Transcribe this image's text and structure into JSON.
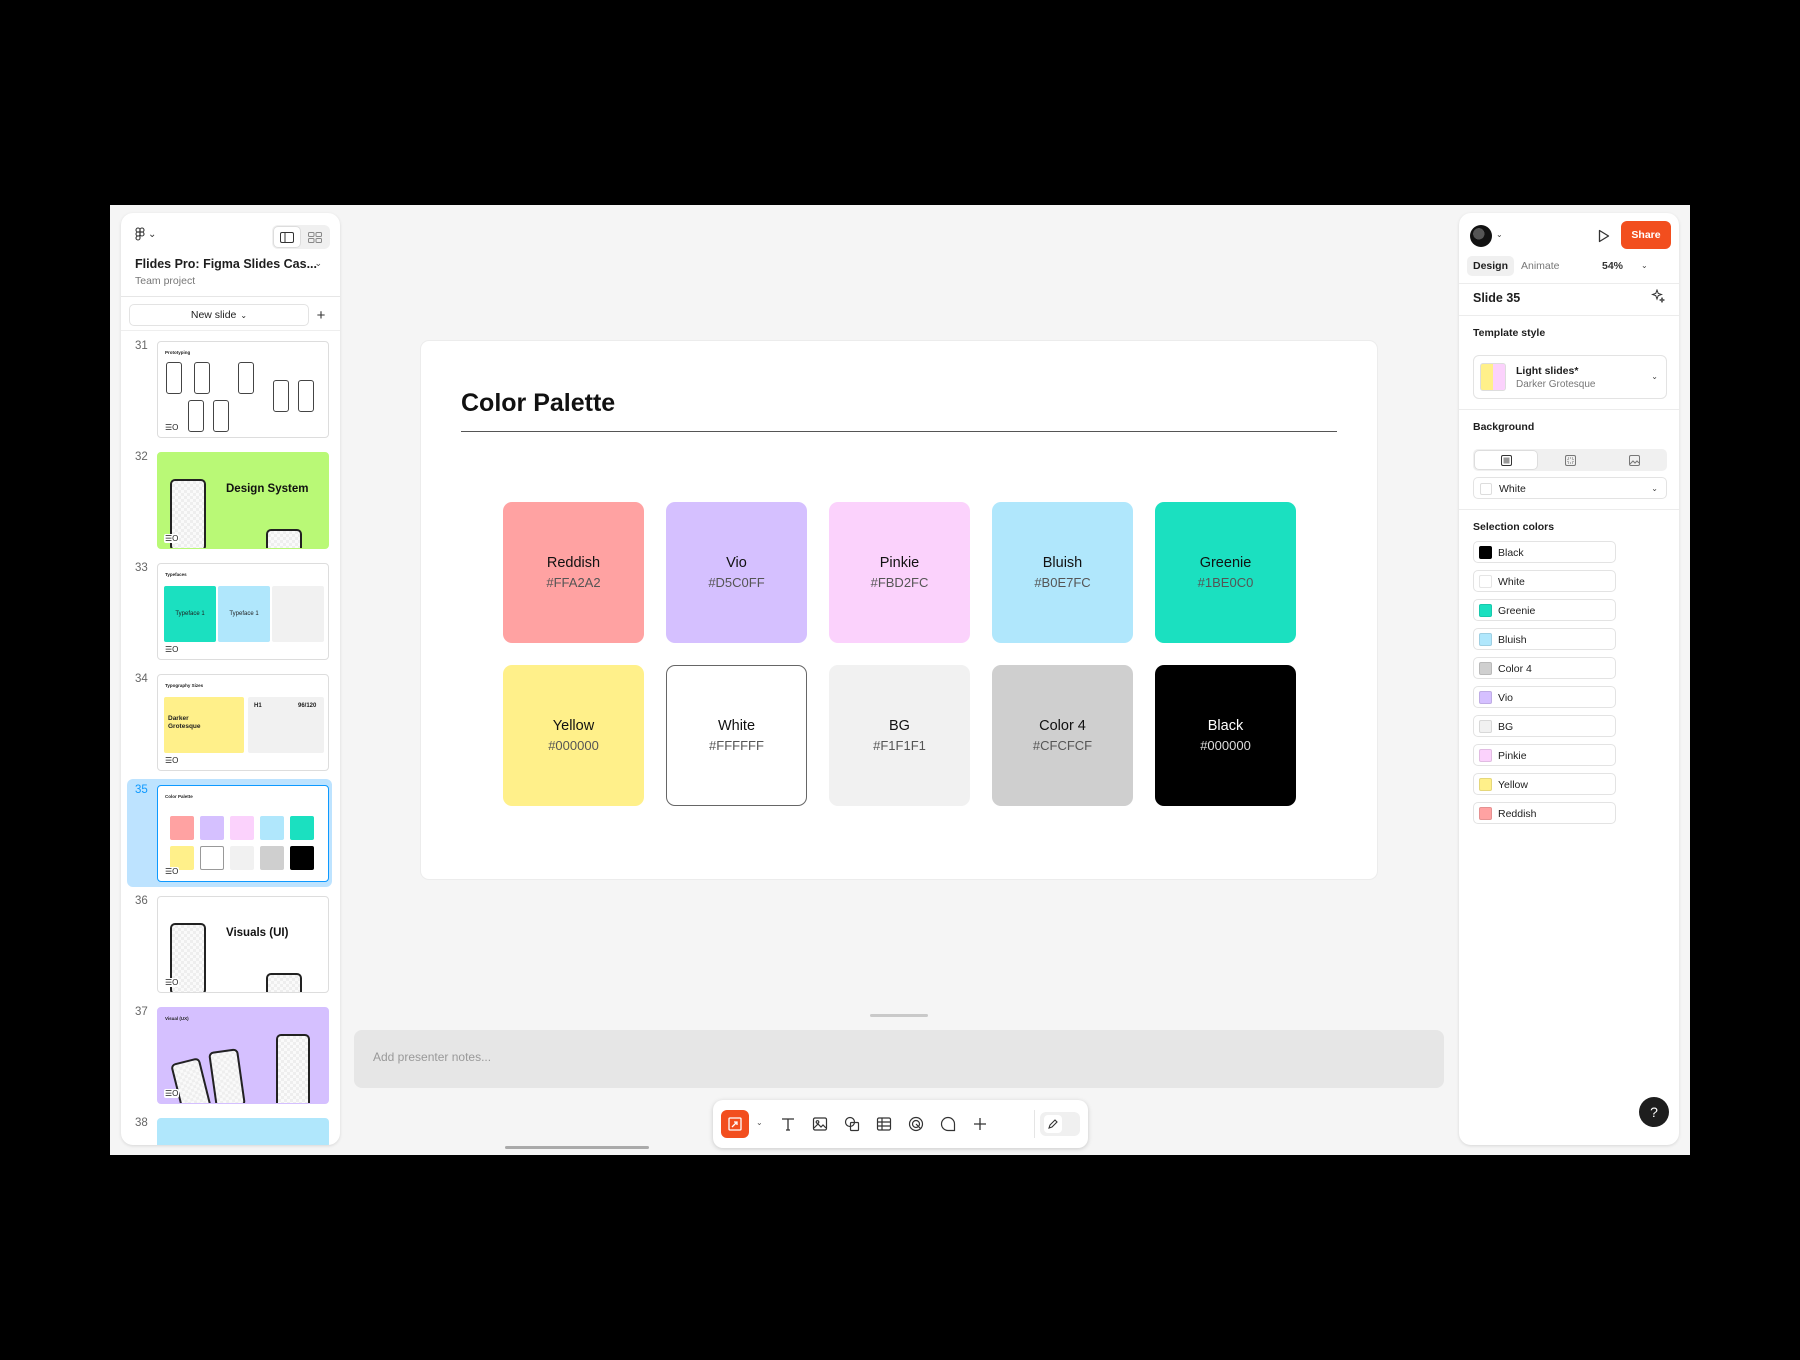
{
  "file": {
    "name": "Flides Pro: Figma Slides Cas...",
    "project": "Team project"
  },
  "left_panel": {
    "new_slide_label": "New slide",
    "slides": [
      {
        "num": "31",
        "title": "Prototyping"
      },
      {
        "num": "32",
        "title": "Design System"
      },
      {
        "num": "33",
        "title": "Typefaces",
        "cells": [
          "Typeface 1",
          "Typeface 1"
        ]
      },
      {
        "num": "34",
        "title": "Typography Sizes",
        "big": "Darker Grotesque",
        "h1": "H1",
        "size": "96/120"
      },
      {
        "num": "35",
        "title": "Color Palette"
      },
      {
        "num": "36",
        "title": "Visuals (UI)"
      },
      {
        "num": "37",
        "title": "Visual (UX)"
      },
      {
        "num": "38"
      }
    ]
  },
  "slide": {
    "title": "Color Palette",
    "cards": [
      {
        "name": "Reddish",
        "hex": "#FFA2A2",
        "color": "#FFA2A2"
      },
      {
        "name": "Vio",
        "hex": "#D5C0FF",
        "color": "#D5C0FF"
      },
      {
        "name": "Pinkie",
        "hex": "#FBD2FC",
        "color": "#FBD2FC"
      },
      {
        "name": "Bluish",
        "hex": "#B0E7FC",
        "color": "#B0E7FC"
      },
      {
        "name": "Greenie",
        "hex": "#1BE0C0",
        "color": "#1BE0C0"
      },
      {
        "name": "Yellow",
        "hex": "#000000",
        "color": "#FFF08A"
      },
      {
        "name": "White",
        "hex": "#FFFFFF",
        "color": "#FFFFFF"
      },
      {
        "name": "BG",
        "hex": "#F1F1F1",
        "color": "#F1F1F1"
      },
      {
        "name": "Color 4",
        "hex": "#CFCFCF",
        "color": "#CFCFCF"
      },
      {
        "name": "Black",
        "hex": "#000000",
        "color": "#000000"
      }
    ]
  },
  "notes": {
    "placeholder": "Add presenter notes..."
  },
  "right_panel": {
    "share_label": "Share",
    "tabs": {
      "design": "Design",
      "animate": "Animate"
    },
    "zoom": "54%",
    "slide_label": "Slide 35",
    "template_style": {
      "heading": "Template style",
      "name": "Light slides*",
      "font": "Darker Grotesque"
    },
    "background": {
      "heading": "Background",
      "value": "White"
    },
    "selection_colors": {
      "heading": "Selection colors",
      "items": [
        {
          "name": "Black",
          "color": "#000000"
        },
        {
          "name": "White",
          "color": "#FFFFFF"
        },
        {
          "name": "Greenie",
          "color": "#1BE0C0"
        },
        {
          "name": "Bluish",
          "color": "#B0E7FC"
        },
        {
          "name": "Color 4",
          "color": "#CFCFCF"
        },
        {
          "name": "Vio",
          "color": "#D5C0FF"
        },
        {
          "name": "BG",
          "color": "#F1F1F1"
        },
        {
          "name": "Pinkie",
          "color": "#FBD2FC"
        },
        {
          "name": "Yellow",
          "color": "#FFF08A"
        },
        {
          "name": "Reddish",
          "color": "#FFA2A2"
        }
      ]
    }
  },
  "help_label": "?",
  "colors": {
    "accent": "#F24E1E",
    "selection": "#BDE3FF"
  }
}
